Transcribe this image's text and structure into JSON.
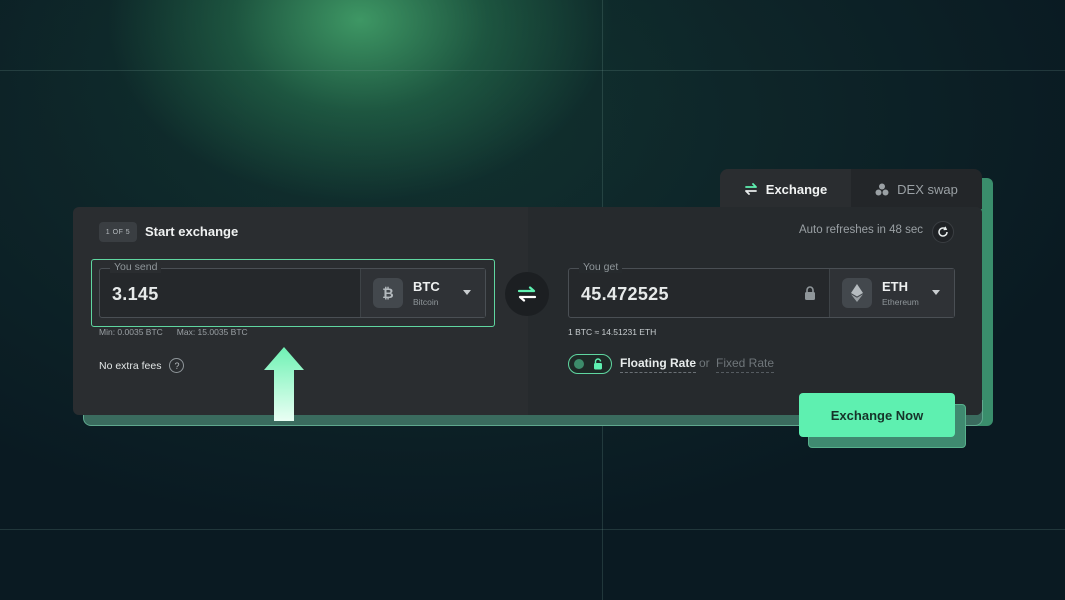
{
  "tabs": {
    "exchange_label": "Exchange",
    "dex_label": "DEX swap",
    "active": "Exchange"
  },
  "header": {
    "step_badge": "1 OF 5",
    "title": "Start exchange",
    "auto_refresh": "Auto refreshes in 48 sec"
  },
  "send": {
    "label": "You send",
    "amount": "3.145",
    "currency_symbol": "BTC",
    "currency_name": "Bitcoin",
    "min": "Min: 0.0035 BTC",
    "max": "Max: 15.0035 BTC"
  },
  "receive": {
    "label": "You get",
    "amount": "45.472525",
    "currency_symbol": "ETH",
    "currency_name": "Ethereum",
    "rate": "1 BTC ≈ 14.51231 ETH"
  },
  "fees": {
    "label": "No extra fees",
    "help": "?"
  },
  "rate_type": {
    "floating": "Floating Rate",
    "or": "or",
    "fixed": "Fixed Rate",
    "selected": "Floating Rate"
  },
  "actions": {
    "exchange_now": "Exchange Now"
  },
  "colors": {
    "accent": "#5ef0b0",
    "background": "#0a1a22",
    "card": "#2a2d30"
  }
}
